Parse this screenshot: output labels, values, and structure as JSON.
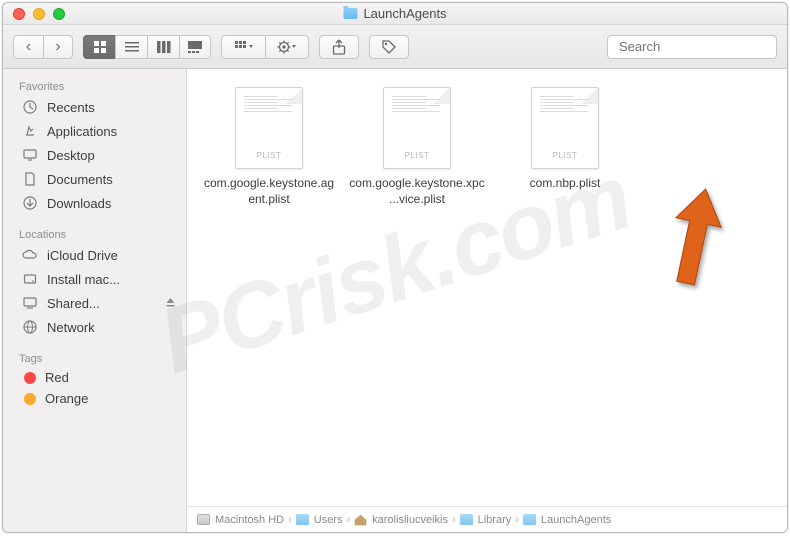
{
  "window": {
    "title": "LaunchAgents"
  },
  "toolbar": {
    "search_placeholder": "Search"
  },
  "sidebar": {
    "sections": [
      {
        "title": "Favorites",
        "items": [
          {
            "label": "Recents",
            "icon": "clock"
          },
          {
            "label": "Applications",
            "icon": "apps"
          },
          {
            "label": "Desktop",
            "icon": "desktop"
          },
          {
            "label": "Documents",
            "icon": "doc"
          },
          {
            "label": "Downloads",
            "icon": "download"
          }
        ]
      },
      {
        "title": "Locations",
        "items": [
          {
            "label": "iCloud Drive",
            "icon": "cloud"
          },
          {
            "label": "Install mac...",
            "icon": "disk"
          },
          {
            "label": "Shared...",
            "icon": "monitor",
            "eject": true
          },
          {
            "label": "Network",
            "icon": "globe"
          }
        ]
      },
      {
        "title": "Tags",
        "items": [
          {
            "label": "Red",
            "tag": "#fb494a"
          },
          {
            "label": "Orange",
            "tag": "#f8aב30"
          }
        ]
      }
    ]
  },
  "tags": {
    "red": "#fb494a",
    "orange": "#f8ab30"
  },
  "files": [
    {
      "name": "com.google.keystone.agent.plist",
      "badge": "PLIST"
    },
    {
      "name": "com.google.keystone.xpc...vice.plist",
      "badge": "PLIST"
    },
    {
      "name": "com.nbp.plist",
      "badge": "PLIST"
    }
  ],
  "path": [
    {
      "label": "Macintosh HD",
      "type": "hdd"
    },
    {
      "label": "Users",
      "type": "fldr"
    },
    {
      "label": "karolisliucveikis",
      "type": "home"
    },
    {
      "label": "Library",
      "type": "fldr"
    },
    {
      "label": "LaunchAgents",
      "type": "fldr"
    }
  ],
  "watermark": "PCrisk.com"
}
